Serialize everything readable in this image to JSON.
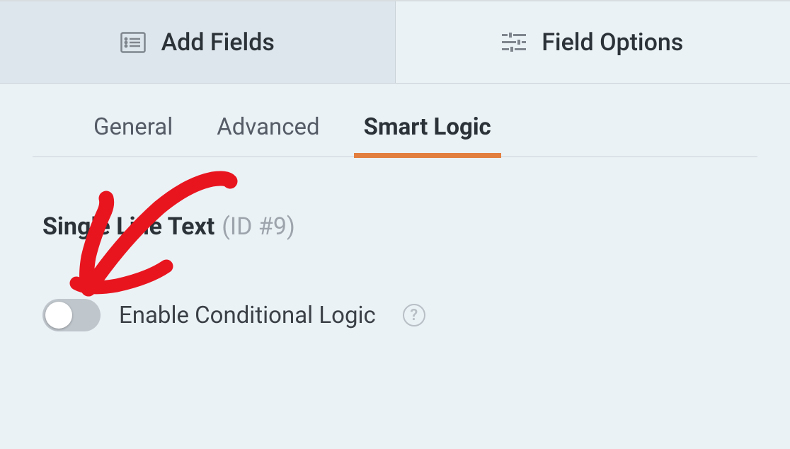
{
  "topTabs": {
    "addFields": "Add Fields",
    "fieldOptions": "Field Options"
  },
  "subTabs": {
    "general": "General",
    "advanced": "Advanced",
    "smartLogic": "Smart Logic"
  },
  "field": {
    "name": "Single Line Text",
    "id": "(ID #9)"
  },
  "toggle": {
    "label": "Enable Conditional Logic",
    "enabled": false
  }
}
